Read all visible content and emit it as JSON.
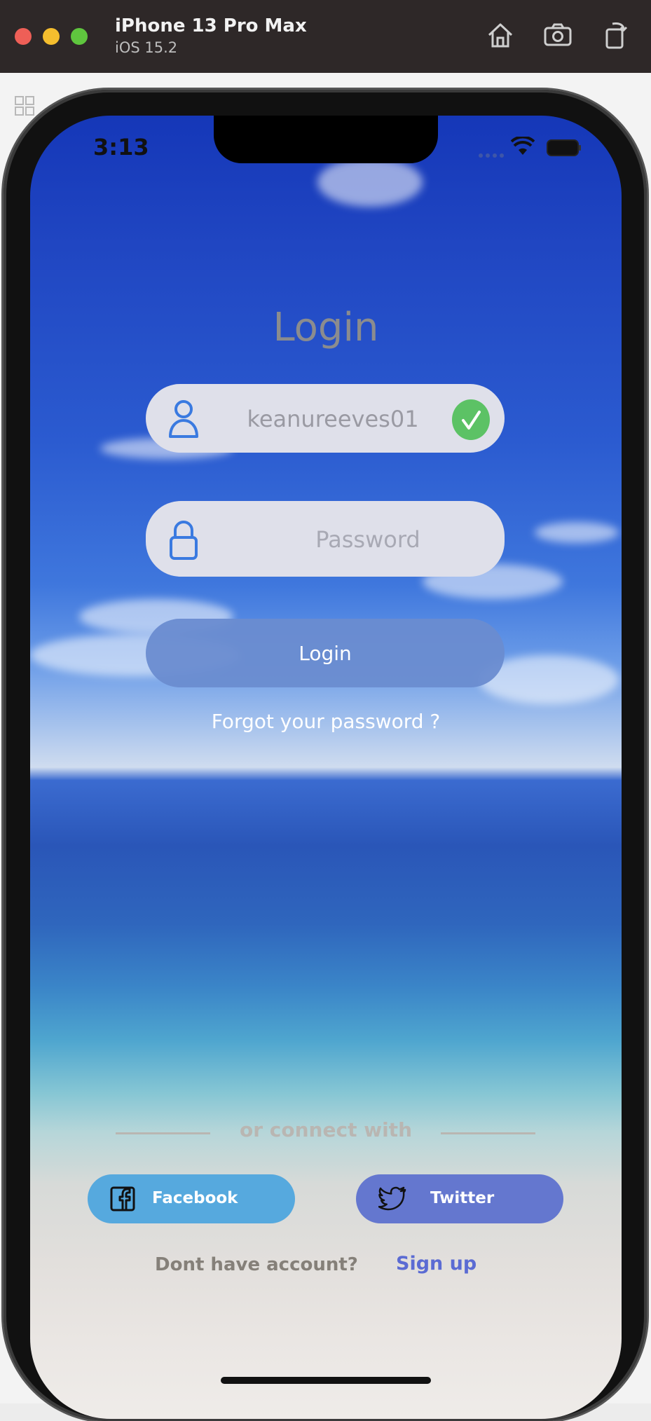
{
  "simulator": {
    "device_name": "iPhone 13 Pro Max",
    "os_version": "iOS 15.2",
    "toolbar_icons": [
      "home-icon",
      "screenshot-icon",
      "rotate-icon"
    ]
  },
  "status_bar": {
    "time": "3:13",
    "icons": [
      "wifi-icon",
      "battery-icon"
    ]
  },
  "login": {
    "title": "Login",
    "username": {
      "value": "keanureeves01",
      "placeholder": "",
      "icon": "user-icon",
      "valid": true
    },
    "password": {
      "value": "",
      "placeholder": "Password",
      "icon": "lock-icon"
    },
    "submit_label": "Login",
    "forgot_label": "Forgot your password ?"
  },
  "social": {
    "divider_label": "or connect with",
    "facebook_label": "Facebook",
    "twitter_label": "Twitter"
  },
  "signup": {
    "prompt": "Dont have account?",
    "link_label": "Sign up"
  },
  "colors": {
    "field_bg": "#dfe0ea",
    "accent_blue": "#3a7ae0",
    "valid_green": "#5cc265",
    "facebook": "#56a9de",
    "twitter": "#6477cf",
    "signup_link": "#5b6bd3"
  }
}
